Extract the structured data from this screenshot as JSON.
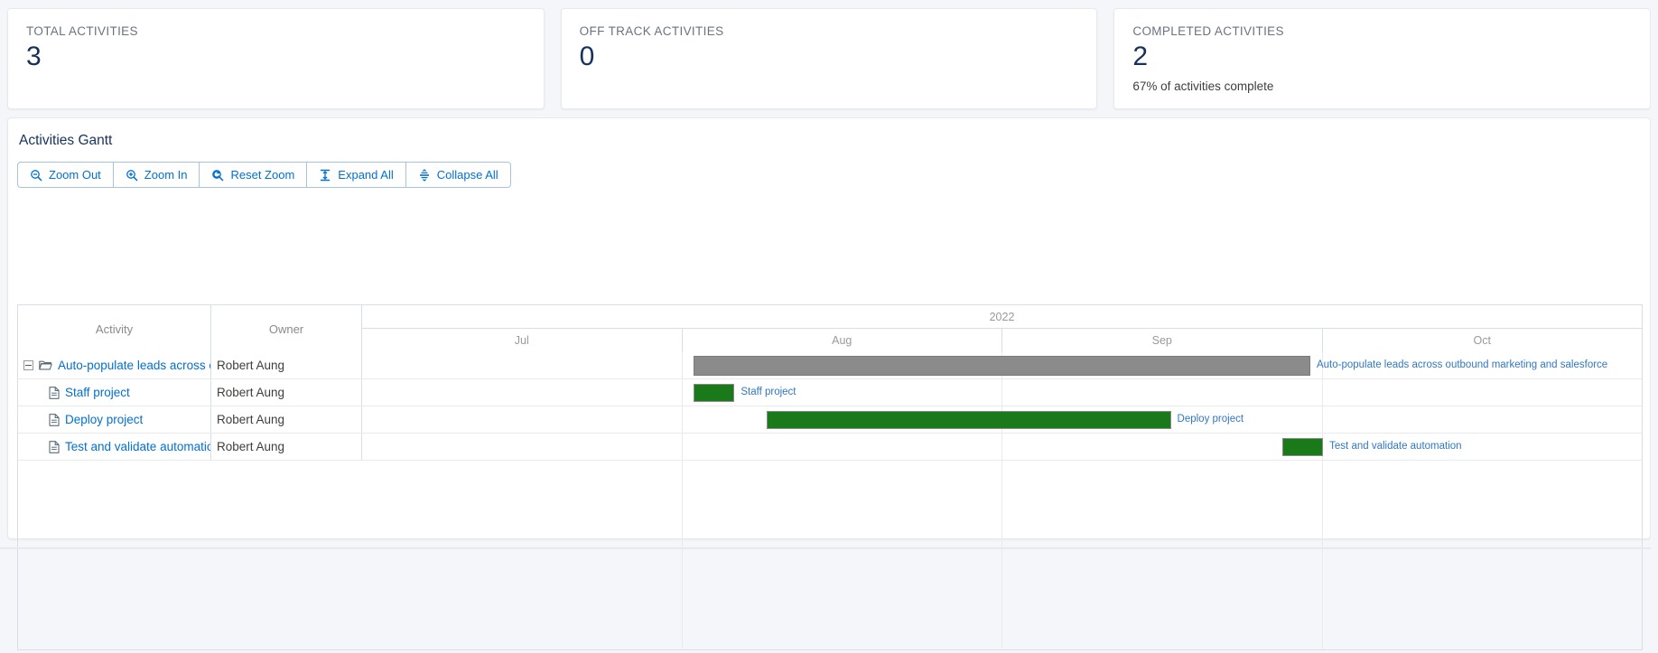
{
  "kpis": [
    {
      "label": "TOTAL ACTIVITIES",
      "value": "3",
      "sub": ""
    },
    {
      "label": "OFF TRACK ACTIVITIES",
      "value": "0",
      "sub": ""
    },
    {
      "label": "COMPLETED ACTIVITIES",
      "value": "2",
      "sub": "67% of activities complete"
    }
  ],
  "panel": {
    "title": "Activities Gantt",
    "toolbar": [
      {
        "label": "Zoom Out",
        "icon": "zoom-out-icon"
      },
      {
        "label": "Zoom In",
        "icon": "zoom-in-icon"
      },
      {
        "label": "Reset Zoom",
        "icon": "reset-zoom-icon"
      },
      {
        "label": "Expand All",
        "icon": "expand-all-icon"
      },
      {
        "label": "Collapse All",
        "icon": "collapse-all-icon"
      }
    ]
  },
  "gantt": {
    "columns": {
      "activity": "Activity",
      "owner": "Owner"
    },
    "year": "2022",
    "months": [
      "Jul",
      "Aug",
      "Sep",
      "Oct"
    ],
    "rows": [
      {
        "name": "Auto-populate leads across outbound marketing and salesforce",
        "owner": "Robert Aung",
        "type": "summary",
        "icon": "folder-open-icon",
        "expanded": true,
        "bar_label": "Auto-populate leads across outbound marketing and salesforce",
        "bar_start_pct": 25.9,
        "bar_width_pct": 48.2,
        "color": "#8b8b8b"
      },
      {
        "name": "Staff project",
        "owner": "Robert Aung",
        "type": "task",
        "icon": "document-icon",
        "bar_label": "Staff project",
        "bar_start_pct": 25.9,
        "bar_width_pct": 3.2,
        "color": "#1a7a1a"
      },
      {
        "name": "Deploy project",
        "owner": "Robert Aung",
        "type": "task",
        "icon": "document-icon",
        "bar_label": "Deploy project",
        "bar_start_pct": 31.6,
        "bar_width_pct": 31.6,
        "color": "#1a7a1a"
      },
      {
        "name": "Test and validate automation",
        "owner": "Robert Aung",
        "type": "task",
        "icon": "document-icon",
        "bar_label": "Test and validate automation",
        "bar_start_pct": 71.9,
        "bar_width_pct": 3.2,
        "color": "#1a7a1a"
      }
    ]
  },
  "colors": {
    "link": "#0070d2",
    "summary_bar": "#8b8b8b",
    "task_bar": "#1a7a1a",
    "page_bg": "#f4f6f9"
  }
}
